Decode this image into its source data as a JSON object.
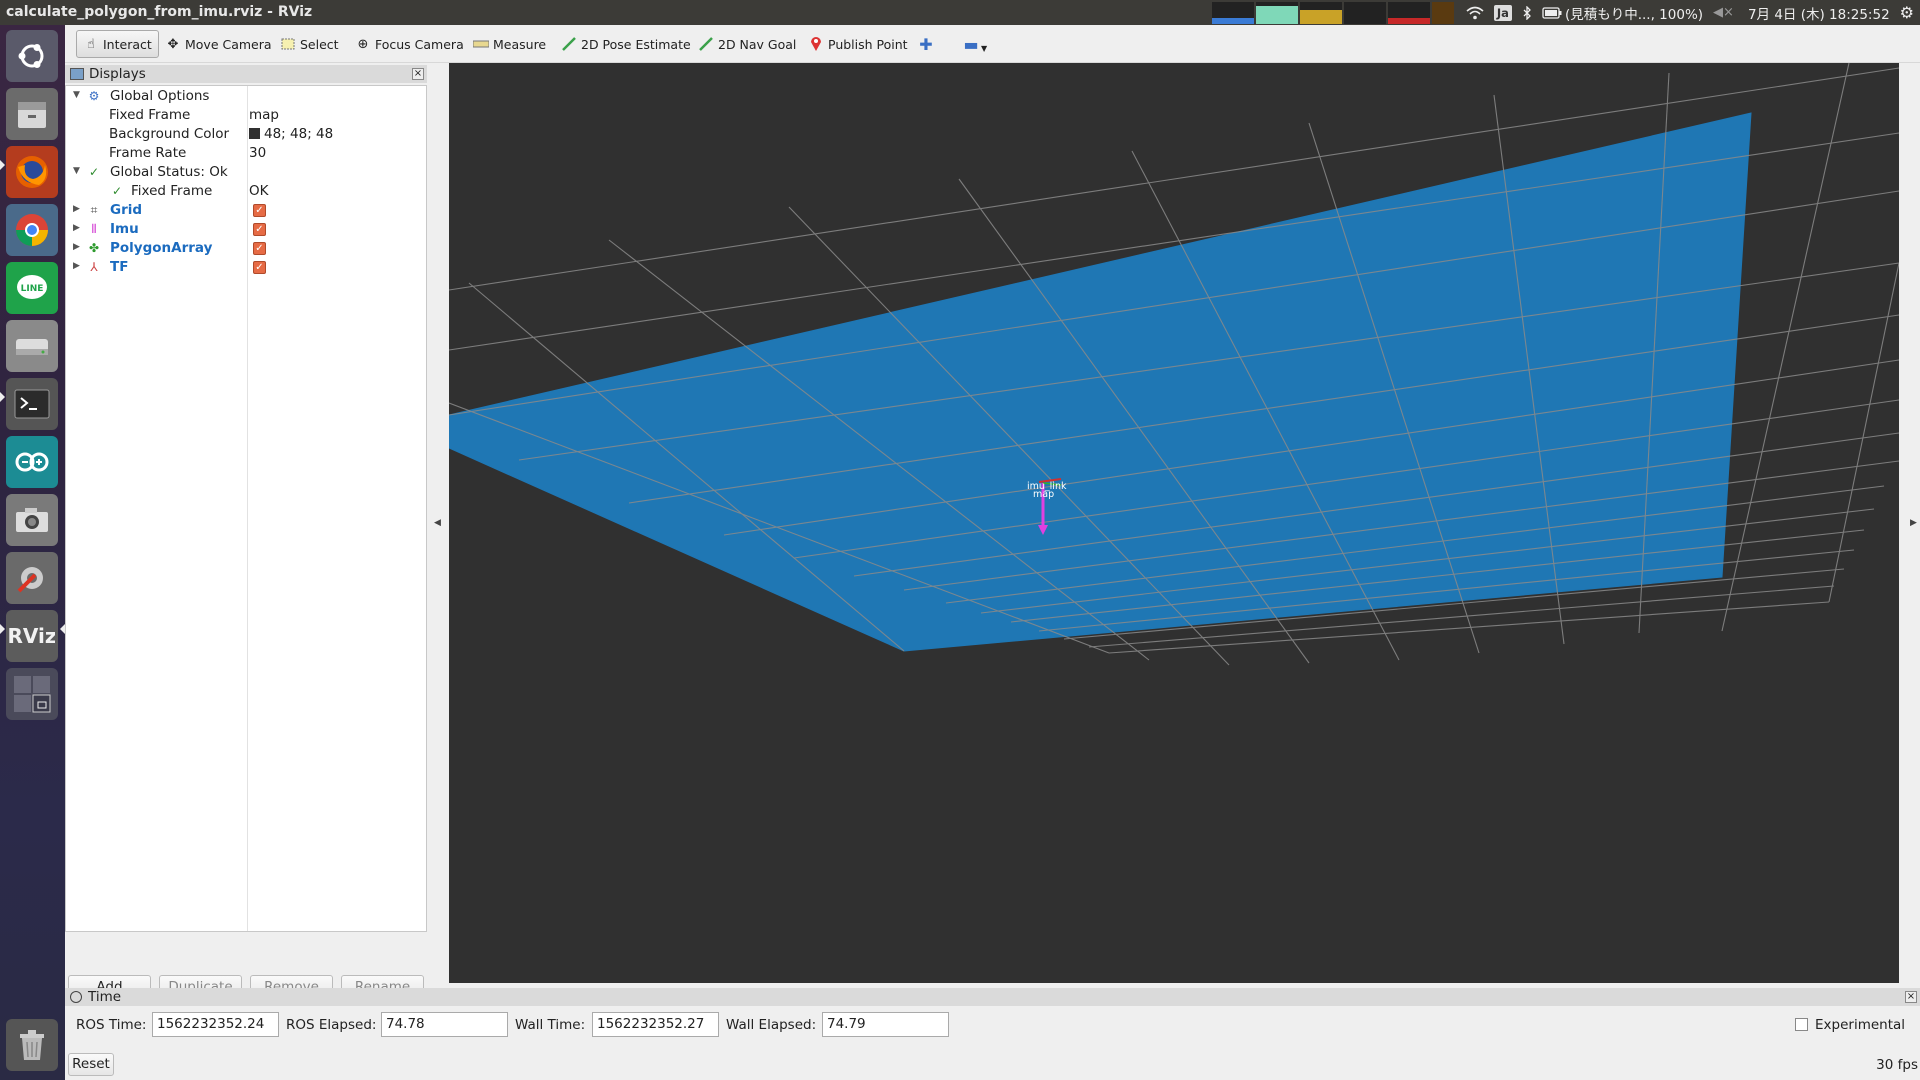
{
  "window": {
    "title": "calculate_polygon_from_imu.rviz - RViz"
  },
  "tray": {
    "input_method": "Ja",
    "battery": "(見積もり中..., 100%)",
    "datetime": "7月 4日 (木) 18:25:52"
  },
  "toolbar": {
    "tools": [
      {
        "label": "Interact",
        "icon": "hand-icon",
        "active": true
      },
      {
        "label": "Move Camera",
        "icon": "move-camera-icon"
      },
      {
        "label": "Select",
        "icon": "select-icon"
      },
      {
        "label": "Focus Camera",
        "icon": "focus-camera-icon"
      },
      {
        "label": "Measure",
        "icon": "ruler-icon"
      },
      {
        "label": "2D Pose Estimate",
        "icon": "green-arrow-icon"
      },
      {
        "label": "2D Nav Goal",
        "icon": "green-arrow-icon"
      },
      {
        "label": "Publish Point",
        "icon": "map-pin-icon"
      }
    ]
  },
  "displays": {
    "title": "Displays",
    "global_options": {
      "label": "Global Options",
      "fixed_frame_label": "Fixed Frame",
      "fixed_frame_value": "map",
      "bg_color_label": "Background Color",
      "bg_color_value": "48; 48; 48",
      "frame_rate_label": "Frame Rate",
      "frame_rate_value": "30"
    },
    "global_status": {
      "label": "Global Status: Ok",
      "fixed_frame_label": "Fixed Frame",
      "fixed_frame_value": "OK"
    },
    "items": [
      {
        "label": "Grid",
        "checked": true
      },
      {
        "label": "Imu",
        "checked": true
      },
      {
        "label": "PolygonArray",
        "checked": true
      },
      {
        "label": "TF",
        "checked": true
      }
    ],
    "buttons": {
      "add": "Add",
      "duplicate": "Duplicate",
      "remove": "Remove",
      "rename": "Rename"
    }
  },
  "view": {
    "background": "#303030",
    "polygon_color": "#1f77b4",
    "frame_labels": [
      "imu_link",
      "map"
    ]
  },
  "time": {
    "title": "Time",
    "ros_time_label": "ROS Time:",
    "ros_time": "1562232352.24",
    "ros_elapsed_label": "ROS Elapsed:",
    "ros_elapsed": "74.78",
    "wall_time_label": "Wall Time:",
    "wall_time": "1562232352.27",
    "wall_elapsed_label": "Wall Elapsed:",
    "wall_elapsed": "74.79",
    "experimental_label": "Experimental"
  },
  "status": {
    "reset": "Reset",
    "fps": "30 fps"
  }
}
